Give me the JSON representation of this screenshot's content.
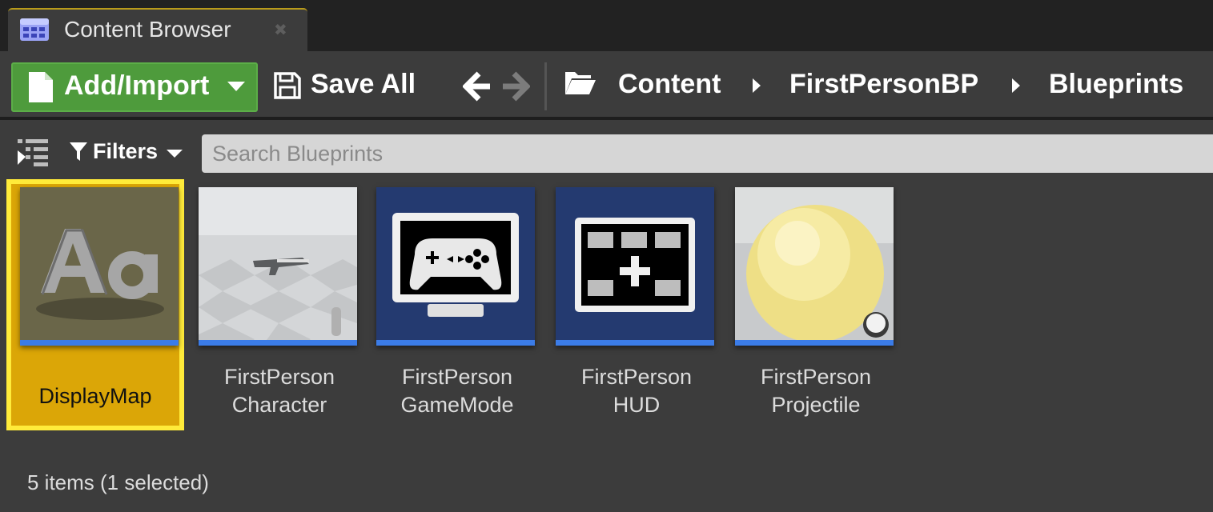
{
  "tab": {
    "title": "Content Browser",
    "close": "✖",
    "icon": "content-browser-icon"
  },
  "toolbar": {
    "add_import": "Add/Import",
    "save_all": "Save All"
  },
  "breadcrumbs": [
    {
      "label": "Content"
    },
    {
      "label": "FirstPersonBP"
    },
    {
      "label": "Blueprints"
    }
  ],
  "filters": {
    "label": "Filters"
  },
  "search": {
    "placeholder": "Search Blueprints",
    "value": ""
  },
  "assets": [
    {
      "name": "DisplayMap",
      "selected": true,
      "thumbnail": "font-aa"
    },
    {
      "name": "FirstPerson\nCharacter",
      "selected": false,
      "thumbnail": "character-gun"
    },
    {
      "name": "FirstPerson\nGameMode",
      "selected": false,
      "thumbnail": "gamepad-monitor"
    },
    {
      "name": "FirstPerson\nHUD",
      "selected": false,
      "thumbnail": "hud-grid"
    },
    {
      "name": "FirstPerson\nProjectile",
      "selected": false,
      "thumbnail": "yellow-sphere"
    }
  ],
  "status": {
    "text": "5 items (1 selected)"
  },
  "colors": {
    "accent_green": "#4e9b3c",
    "selection_fill": "#dba607",
    "selection_border": "#ffeb3a",
    "asset_bar": "#3b7ce8"
  }
}
